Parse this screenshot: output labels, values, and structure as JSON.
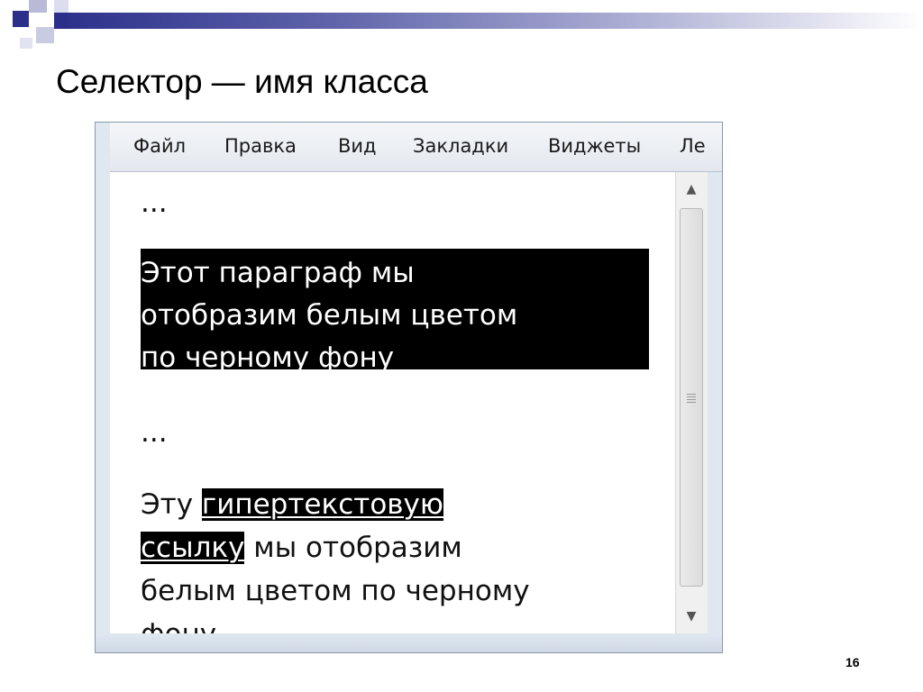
{
  "slide": {
    "title": "Селектор — имя класса",
    "page_number": "16",
    "accent_color": "#2b2f8a"
  },
  "browser": {
    "menu": [
      "Файл",
      "Правка",
      "Вид",
      "Закладки",
      "Виджеты",
      "Ле"
    ],
    "content": {
      "ellipsis_1": "...",
      "black_paragraph_lines": [
        "Этот параграф мы",
        "отобразим белым цветом",
        "по черному фону"
      ],
      "ellipsis_2": "...",
      "link_line1_before": "Эту ",
      "link_line1_link": "гипертекстовую",
      "link_line2_link": "ссылку",
      "link_line2_after": " мы отобразим",
      "link_line3": "белым цветом по черному",
      "link_line4": "фону."
    },
    "scrollbar": {
      "up_icon": "scroll-up-arrow",
      "down_icon": "scroll-down-arrow"
    }
  }
}
